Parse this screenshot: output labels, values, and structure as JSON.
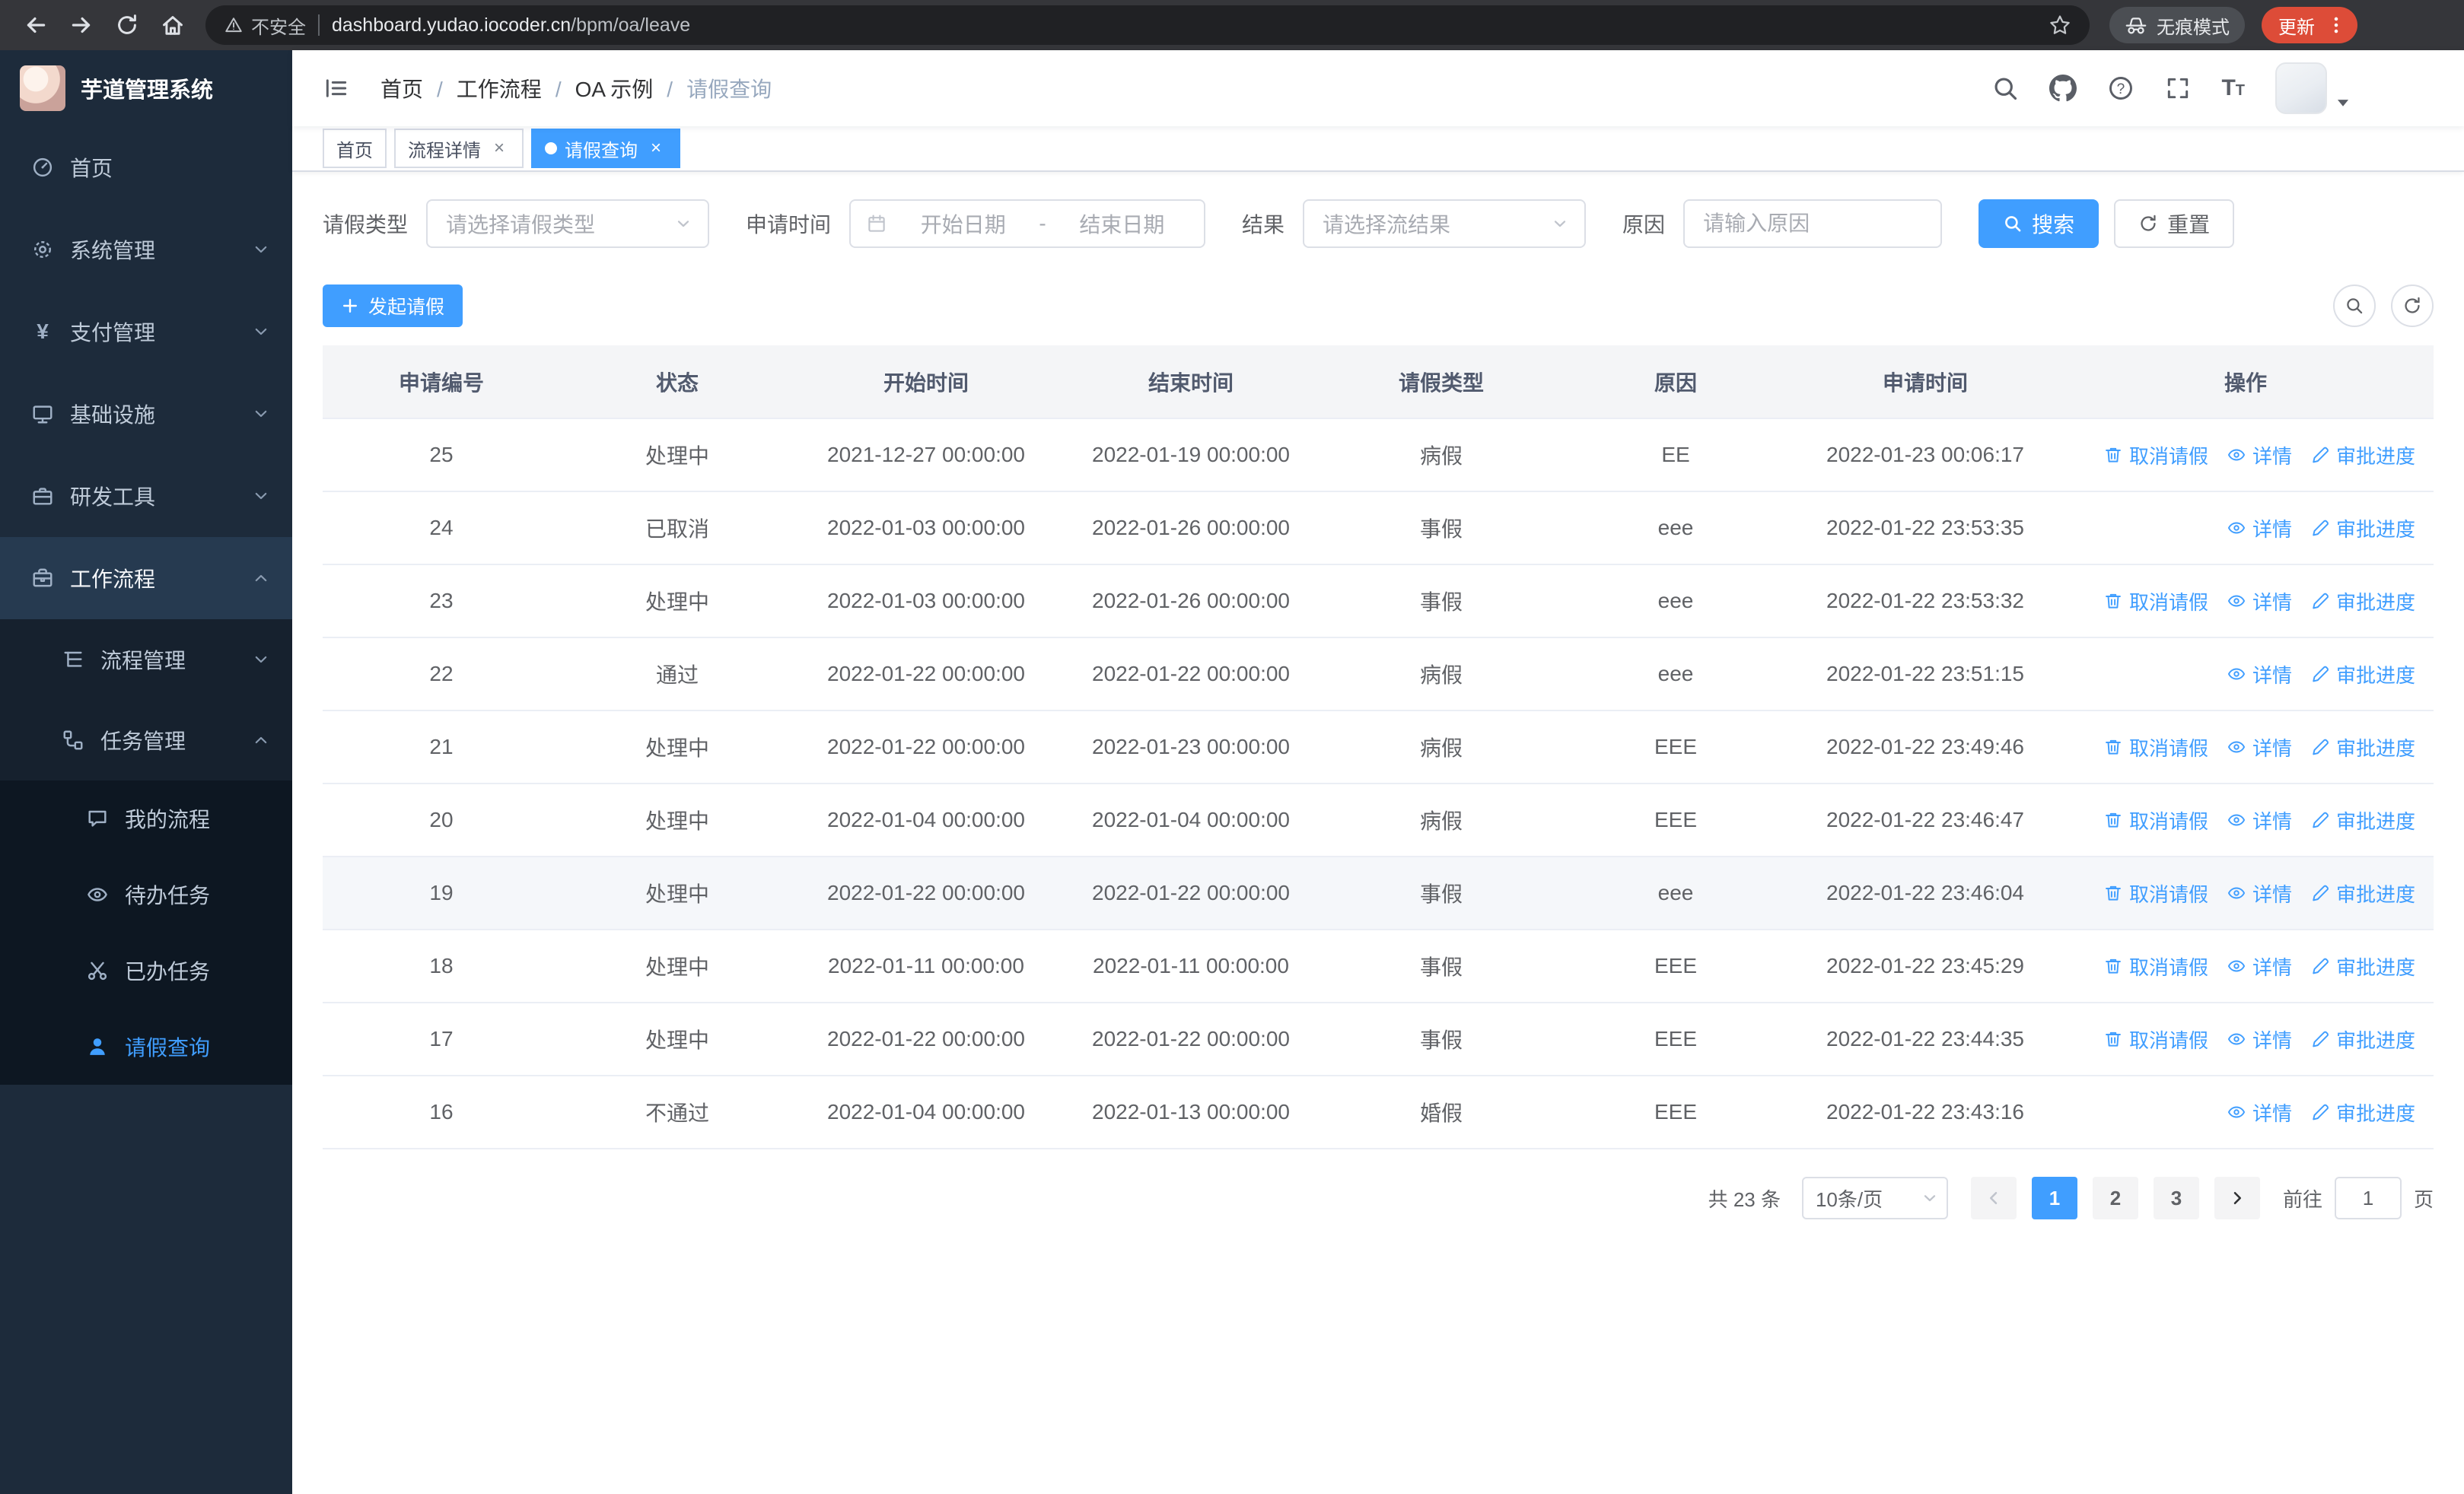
{
  "theme": {
    "primary": "#409eff",
    "sidebar_bg": "#1d2b3b",
    "sidebar_submenu_bg": "#16212e",
    "sidebar_subsub_bg": "#0d1722",
    "chrome_bar_bg": "#35363a",
    "update_badge_bg": "#dd4c38",
    "table_header_bg": "#f4f5f7",
    "hover_row_bg": "#f5f7fa"
  },
  "browser": {
    "security_label": "不安全",
    "url_domain": "dashboard.yudao.iocoder.cn",
    "url_path": "/bpm/oa/leave",
    "incognito_label": "无痕模式",
    "update_label": "更新",
    "icons": [
      "back-icon",
      "forward-icon",
      "reload-icon",
      "home-icon",
      "warning-icon",
      "bookmark-star-icon",
      "incognito-icon",
      "kebab-menu-icon"
    ]
  },
  "sidebar": {
    "title": "芋道管理系统",
    "items": [
      {
        "label": "首页",
        "icon": "dashboard-icon",
        "level": 1,
        "expandable": false
      },
      {
        "label": "系统管理",
        "icon": "gear-icon",
        "level": 1,
        "expandable": true,
        "expanded": false
      },
      {
        "label": "支付管理",
        "icon": "yen-icon",
        "level": 1,
        "expandable": true,
        "expanded": false
      },
      {
        "label": "基础设施",
        "icon": "monitor-icon",
        "level": 1,
        "expandable": true,
        "expanded": false
      },
      {
        "label": "研发工具",
        "icon": "toolbox-icon",
        "level": 1,
        "expandable": true,
        "expanded": false
      },
      {
        "label": "工作流程",
        "icon": "briefcase-icon",
        "level": 1,
        "expandable": true,
        "expanded": true
      },
      {
        "label": "流程管理",
        "icon": "tree-icon",
        "level": 2,
        "expandable": true,
        "expanded": false
      },
      {
        "label": "任务管理",
        "icon": "relation-icon",
        "level": 2,
        "expandable": true,
        "expanded": true
      },
      {
        "label": "我的流程",
        "icon": "chat-icon",
        "level": 3,
        "expandable": false
      },
      {
        "label": "待办任务",
        "icon": "eye-icon",
        "level": 3,
        "expandable": false
      },
      {
        "label": "已办任务",
        "icon": "scissors-icon",
        "level": 3,
        "expandable": false
      },
      {
        "label": "请假查询",
        "icon": "user-icon",
        "level": 3,
        "expandable": false,
        "active": true
      }
    ]
  },
  "header": {
    "breadcrumb": [
      "首页",
      "工作流程",
      "OA 示例",
      "请假查询"
    ],
    "icons": [
      "hamburger-icon",
      "search-icon",
      "github-icon",
      "help-icon",
      "fullscreen-icon",
      "font-size-icon",
      "avatar",
      "caret-down-icon"
    ]
  },
  "tabs": [
    {
      "label": "首页",
      "closable": false,
      "active": false
    },
    {
      "label": "流程详情",
      "closable": true,
      "active": false
    },
    {
      "label": "请假查询",
      "closable": true,
      "active": true
    }
  ],
  "filters": {
    "leave_type_label": "请假类型",
    "leave_type_placeholder": "请选择请假类型",
    "apply_time_label": "申请时间",
    "date_start_placeholder": "开始日期",
    "date_separator": "-",
    "date_end_placeholder": "结束日期",
    "result_label": "结果",
    "result_placeholder": "请选择流结果",
    "reason_label": "原因",
    "reason_placeholder": "请输入原因",
    "search_label": "搜索",
    "reset_label": "重置"
  },
  "toolbar": {
    "create_label": "发起请假",
    "icons": [
      "plus-icon",
      "search-toggle-icon",
      "refresh-icon"
    ]
  },
  "table": {
    "columns": [
      "申请编号",
      "状态",
      "开始时间",
      "结束时间",
      "请假类型",
      "原因",
      "申请时间",
      "操作"
    ],
    "ops": {
      "cancel": "取消请假",
      "detail": "详情",
      "progress": "审批进度"
    },
    "op_icons": {
      "cancel": "delete-icon",
      "detail": "view-icon",
      "progress": "edit-icon"
    },
    "rows": [
      {
        "id": "25",
        "status": "处理中",
        "start": "2021-12-27 00:00:00",
        "end": "2022-01-19 00:00:00",
        "type": "病假",
        "reason": "EE",
        "applied": "2022-01-23 00:06:17",
        "can_cancel": true,
        "highlighted": false
      },
      {
        "id": "24",
        "status": "已取消",
        "start": "2022-01-03 00:00:00",
        "end": "2022-01-26 00:00:00",
        "type": "事假",
        "reason": "eee",
        "applied": "2022-01-22 23:53:35",
        "can_cancel": false,
        "highlighted": false
      },
      {
        "id": "23",
        "status": "处理中",
        "start": "2022-01-03 00:00:00",
        "end": "2022-01-26 00:00:00",
        "type": "事假",
        "reason": "eee",
        "applied": "2022-01-22 23:53:32",
        "can_cancel": true,
        "highlighted": false
      },
      {
        "id": "22",
        "status": "通过",
        "start": "2022-01-22 00:00:00",
        "end": "2022-01-22 00:00:00",
        "type": "病假",
        "reason": "eee",
        "applied": "2022-01-22 23:51:15",
        "can_cancel": false,
        "highlighted": false
      },
      {
        "id": "21",
        "status": "处理中",
        "start": "2022-01-22 00:00:00",
        "end": "2022-01-23 00:00:00",
        "type": "病假",
        "reason": "EEE",
        "applied": "2022-01-22 23:49:46",
        "can_cancel": true,
        "highlighted": false
      },
      {
        "id": "20",
        "status": "处理中",
        "start": "2022-01-04 00:00:00",
        "end": "2022-01-04 00:00:00",
        "type": "病假",
        "reason": "EEE",
        "applied": "2022-01-22 23:46:47",
        "can_cancel": true,
        "highlighted": false
      },
      {
        "id": "19",
        "status": "处理中",
        "start": "2022-01-22 00:00:00",
        "end": "2022-01-22 00:00:00",
        "type": "事假",
        "reason": "eee",
        "applied": "2022-01-22 23:46:04",
        "can_cancel": true,
        "highlighted": true
      },
      {
        "id": "18",
        "status": "处理中",
        "start": "2022-01-11 00:00:00",
        "end": "2022-01-11 00:00:00",
        "type": "事假",
        "reason": "EEE",
        "applied": "2022-01-22 23:45:29",
        "can_cancel": true,
        "highlighted": false
      },
      {
        "id": "17",
        "status": "处理中",
        "start": "2022-01-22 00:00:00",
        "end": "2022-01-22 00:00:00",
        "type": "事假",
        "reason": "EEE",
        "applied": "2022-01-22 23:44:35",
        "can_cancel": true,
        "highlighted": false
      },
      {
        "id": "16",
        "status": "不通过",
        "start": "2022-01-04 00:00:00",
        "end": "2022-01-13 00:00:00",
        "type": "婚假",
        "reason": "EEE",
        "applied": "2022-01-22 23:43:16",
        "can_cancel": false,
        "highlighted": false
      }
    ]
  },
  "pagination": {
    "total": "共 23 条",
    "page_size": "10条/页",
    "pages": [
      "1",
      "2",
      "3"
    ],
    "active_page": "1",
    "goto_label": "前往",
    "goto_value": "1",
    "unit_label": "页"
  }
}
